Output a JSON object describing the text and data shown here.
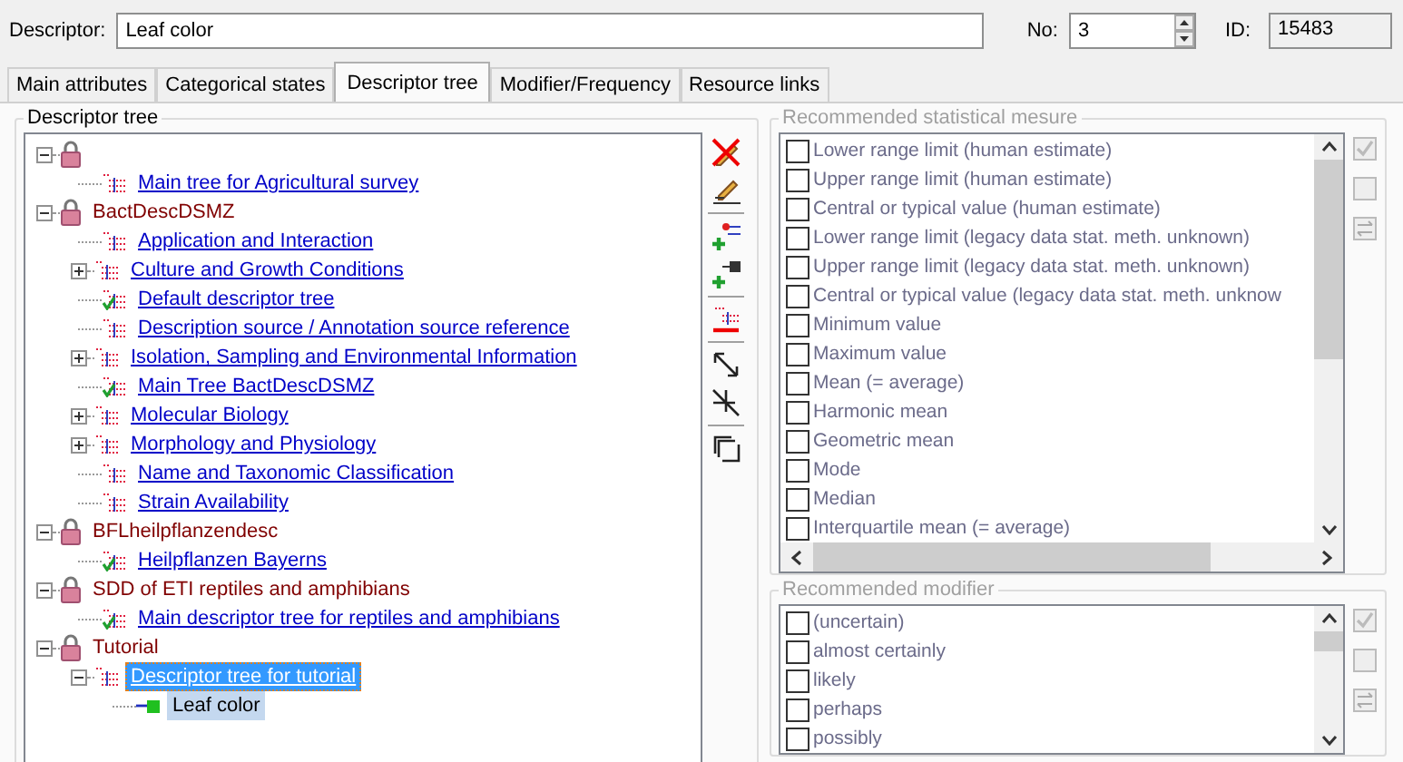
{
  "descriptor": {
    "label": "Descriptor:",
    "value": "Leaf color"
  },
  "number": {
    "label": "No:",
    "value": "3"
  },
  "id": {
    "label": "ID:",
    "value": "15483"
  },
  "tabs": [
    {
      "label": "Main attributes",
      "selected": false
    },
    {
      "label": "Categorical states",
      "selected": false
    },
    {
      "label": "Descriptor tree",
      "selected": true
    },
    {
      "label": "Modifier/Frequency",
      "selected": false
    },
    {
      "label": "Resource links",
      "selected": false
    }
  ],
  "descriptor_tree": {
    "title": "Descriptor tree",
    "items": [
      {
        "kind": "project",
        "expanded": true,
        "children": [
          {
            "kind": "tree",
            "label": "Main tree for Agricultural survey",
            "default": false,
            "selected": false
          }
        ]
      },
      {
        "kind": "project",
        "label": "BactDescDSMZ",
        "expanded": true,
        "selected": false,
        "children": [
          {
            "kind": "tree",
            "label": "Application and Interaction",
            "default": false,
            "selected": false
          },
          {
            "kind": "tree",
            "label": "Culture and Growth Conditions",
            "default": false,
            "expanded": false,
            "selected": false
          },
          {
            "kind": "tree",
            "label": "Default descriptor tree",
            "default": true,
            "selected": false
          },
          {
            "kind": "tree",
            "label": "Description source / Annotation source reference",
            "default": false,
            "selected": false
          },
          {
            "kind": "tree",
            "label": "Isolation, Sampling and Environmental Information",
            "default": false,
            "expanded": false,
            "selected": false
          },
          {
            "kind": "tree",
            "label": "Main Tree BactDescDSMZ",
            "default": true,
            "selected": false
          },
          {
            "kind": "tree",
            "label": "Molecular Biology",
            "default": false,
            "expanded": false,
            "selected": false
          },
          {
            "kind": "tree",
            "label": "Morphology and Physiology",
            "default": false,
            "expanded": false,
            "selected": false
          },
          {
            "kind": "tree",
            "label": "Name and Taxonomic Classification",
            "default": false,
            "selected": false
          },
          {
            "kind": "tree",
            "label": "Strain Availability",
            "default": false,
            "selected": false
          }
        ]
      },
      {
        "kind": "project",
        "label": "BFLheilpflanzendesc",
        "expanded": true,
        "selected": false,
        "children": [
          {
            "kind": "tree",
            "label": "Heilpflanzen Bayerns",
            "default": true,
            "selected": false
          }
        ]
      },
      {
        "kind": "project",
        "label": "SDD of ETI reptiles and amphibians",
        "expanded": true,
        "selected": false,
        "children": [
          {
            "kind": "tree",
            "label": "Main descriptor tree for reptiles and amphibians",
            "default": true,
            "selected": false
          }
        ]
      },
      {
        "kind": "project",
        "label": "Tutorial",
        "expanded": true,
        "selected": false,
        "children": [
          {
            "kind": "tree",
            "label": "Descriptor tree for tutorial",
            "default": false,
            "expanded": true,
            "selected": true,
            "children": [
              {
                "kind": "descriptor",
                "label": "Leaf color",
                "selected": true
              }
            ]
          }
        ]
      }
    ]
  },
  "statistical_measures": {
    "title": "Recommended statistical mesure",
    "items": [
      {
        "label": "Lower range limit (human estimate)",
        "checked": false
      },
      {
        "label": "Upper range limit (human estimate)",
        "checked": false
      },
      {
        "label": "Central or typical value (human estimate)",
        "checked": false
      },
      {
        "label": "Lower range limit (legacy data stat. meth. unknown)",
        "checked": false
      },
      {
        "label": "Upper range limit (legacy data stat. meth. unknown)",
        "checked": false
      },
      {
        "label": "Central or typical value (legacy data stat. meth. unknow",
        "checked": false
      },
      {
        "label": "Minimum value",
        "checked": false
      },
      {
        "label": "Maximum value",
        "checked": false
      },
      {
        "label": "Mean (= average)",
        "checked": false
      },
      {
        "label": "Harmonic mean",
        "checked": false
      },
      {
        "label": "Geometric mean",
        "checked": false
      },
      {
        "label": "Mode",
        "checked": false
      },
      {
        "label": "Median",
        "checked": false
      },
      {
        "label": "Interquartile mean (= average)",
        "checked": false
      }
    ]
  },
  "modifiers": {
    "title": "Recommended modifier",
    "items": [
      {
        "label": "(uncertain)",
        "checked": false
      },
      {
        "label": "almost certainly",
        "checked": false
      },
      {
        "label": "likely",
        "checked": false
      },
      {
        "label": "perhaps",
        "checked": false
      },
      {
        "label": "possibly",
        "checked": false
      }
    ]
  }
}
